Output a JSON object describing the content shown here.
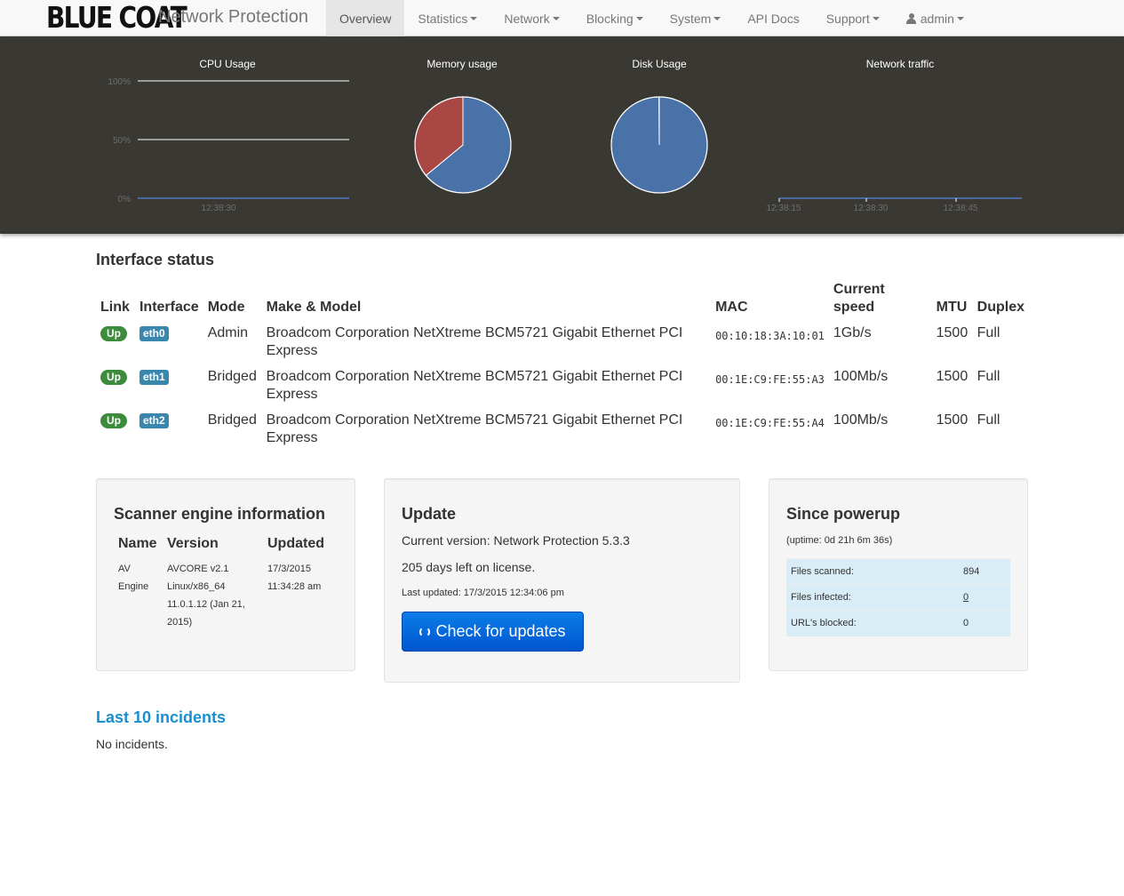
{
  "brand": {
    "logo_text": "BLUE COAT",
    "product": "Network Protection"
  },
  "nav": {
    "overview": "Overview",
    "statistics": "Statistics",
    "network": "Network",
    "blocking": "Blocking",
    "system": "System",
    "api_docs": "API Docs",
    "support": "Support",
    "user": "admin"
  },
  "charts": {
    "cpu_title": "CPU Usage",
    "memory_title": "Memory usage",
    "disk_title": "Disk Usage",
    "network_title": "Network traffic"
  },
  "chart_data": [
    {
      "type": "line",
      "title": "CPU Usage",
      "y_ticks": [
        "100%",
        "50%",
        "0%"
      ],
      "ylim": [
        0,
        100
      ],
      "x_ticks": [
        "12:38:30"
      ],
      "series": [
        {
          "values": [
            0,
            0
          ]
        }
      ],
      "grid": true
    },
    {
      "type": "pie",
      "title": "Memory usage",
      "slices": [
        {
          "value": 0.64,
          "color": "#4872a8"
        },
        {
          "value": 0.36,
          "color": "#a84743"
        }
      ]
    },
    {
      "type": "pie",
      "title": "Disk Usage",
      "slices": [
        {
          "value": 0.999,
          "color": "#4872a8"
        },
        {
          "value": 0.001,
          "color": "#a84743"
        }
      ]
    },
    {
      "type": "line",
      "title": "Network traffic",
      "x_ticks": [
        "12:38:15",
        "12:38:30",
        "12:38:45"
      ],
      "series": [
        {
          "values": [
            0,
            0
          ]
        }
      ]
    }
  ],
  "interface_status": {
    "title": "Interface status",
    "headers": {
      "link": "Link",
      "interface": "Interface",
      "mode": "Mode",
      "model": "Make & Model",
      "mac": "MAC",
      "speed_1": "Current",
      "speed_2": "speed",
      "mtu": "MTU",
      "duplex": "Duplex"
    },
    "rows": [
      {
        "link": "Up",
        "iface": "eth0",
        "mode": "Admin",
        "model": "Broadcom Corporation NetXtreme BCM5721 Gigabit Ethernet PCI Express",
        "mac": "00:10:18:3A:10:01",
        "speed": "1Gb/s",
        "mtu": "1500",
        "duplex": "Full"
      },
      {
        "link": "Up",
        "iface": "eth1",
        "mode": "Bridged",
        "model": "Broadcom Corporation NetXtreme BCM5721 Gigabit Ethernet PCI Express",
        "mac": "00:1E:C9:FE:55:A3",
        "speed": "100Mb/s",
        "mtu": "1500",
        "duplex": "Full"
      },
      {
        "link": "Up",
        "iface": "eth2",
        "mode": "Bridged",
        "model": "Broadcom Corporation NetXtreme BCM5721 Gigabit Ethernet PCI Express",
        "mac": "00:1E:C9:FE:55:A4",
        "speed": "100Mb/s",
        "mtu": "1500",
        "duplex": "Full"
      }
    ]
  },
  "scanner": {
    "title": "Scanner engine information",
    "headers": {
      "name": "Name",
      "version": "Version",
      "updated": "Updated"
    },
    "name": "AV Engine",
    "version": "AVCORE v2.1 Linux/x86_64 11.0.1.12 (Jan 21, 2015)",
    "updated": "17/3/2015 11:34:28 am"
  },
  "update": {
    "title": "Update",
    "current_version": "Current version: Network Protection 5.3.3",
    "license": "205 days left on license.",
    "last_updated": "Last updated: 17/3/2015 12:34:06 pm",
    "button": "Check for updates"
  },
  "powerup": {
    "title": "Since powerup",
    "uptime": "(uptime: 0d 21h 6m 36s)",
    "files_scanned_label": "Files scanned:",
    "files_scanned": "894",
    "files_infected_label": "Files infected:",
    "files_infected": "0",
    "urls_blocked_label": "URL's blocked:",
    "urls_blocked": "0"
  },
  "incidents": {
    "title": "Last 10 incidents",
    "empty": "No incidents."
  }
}
